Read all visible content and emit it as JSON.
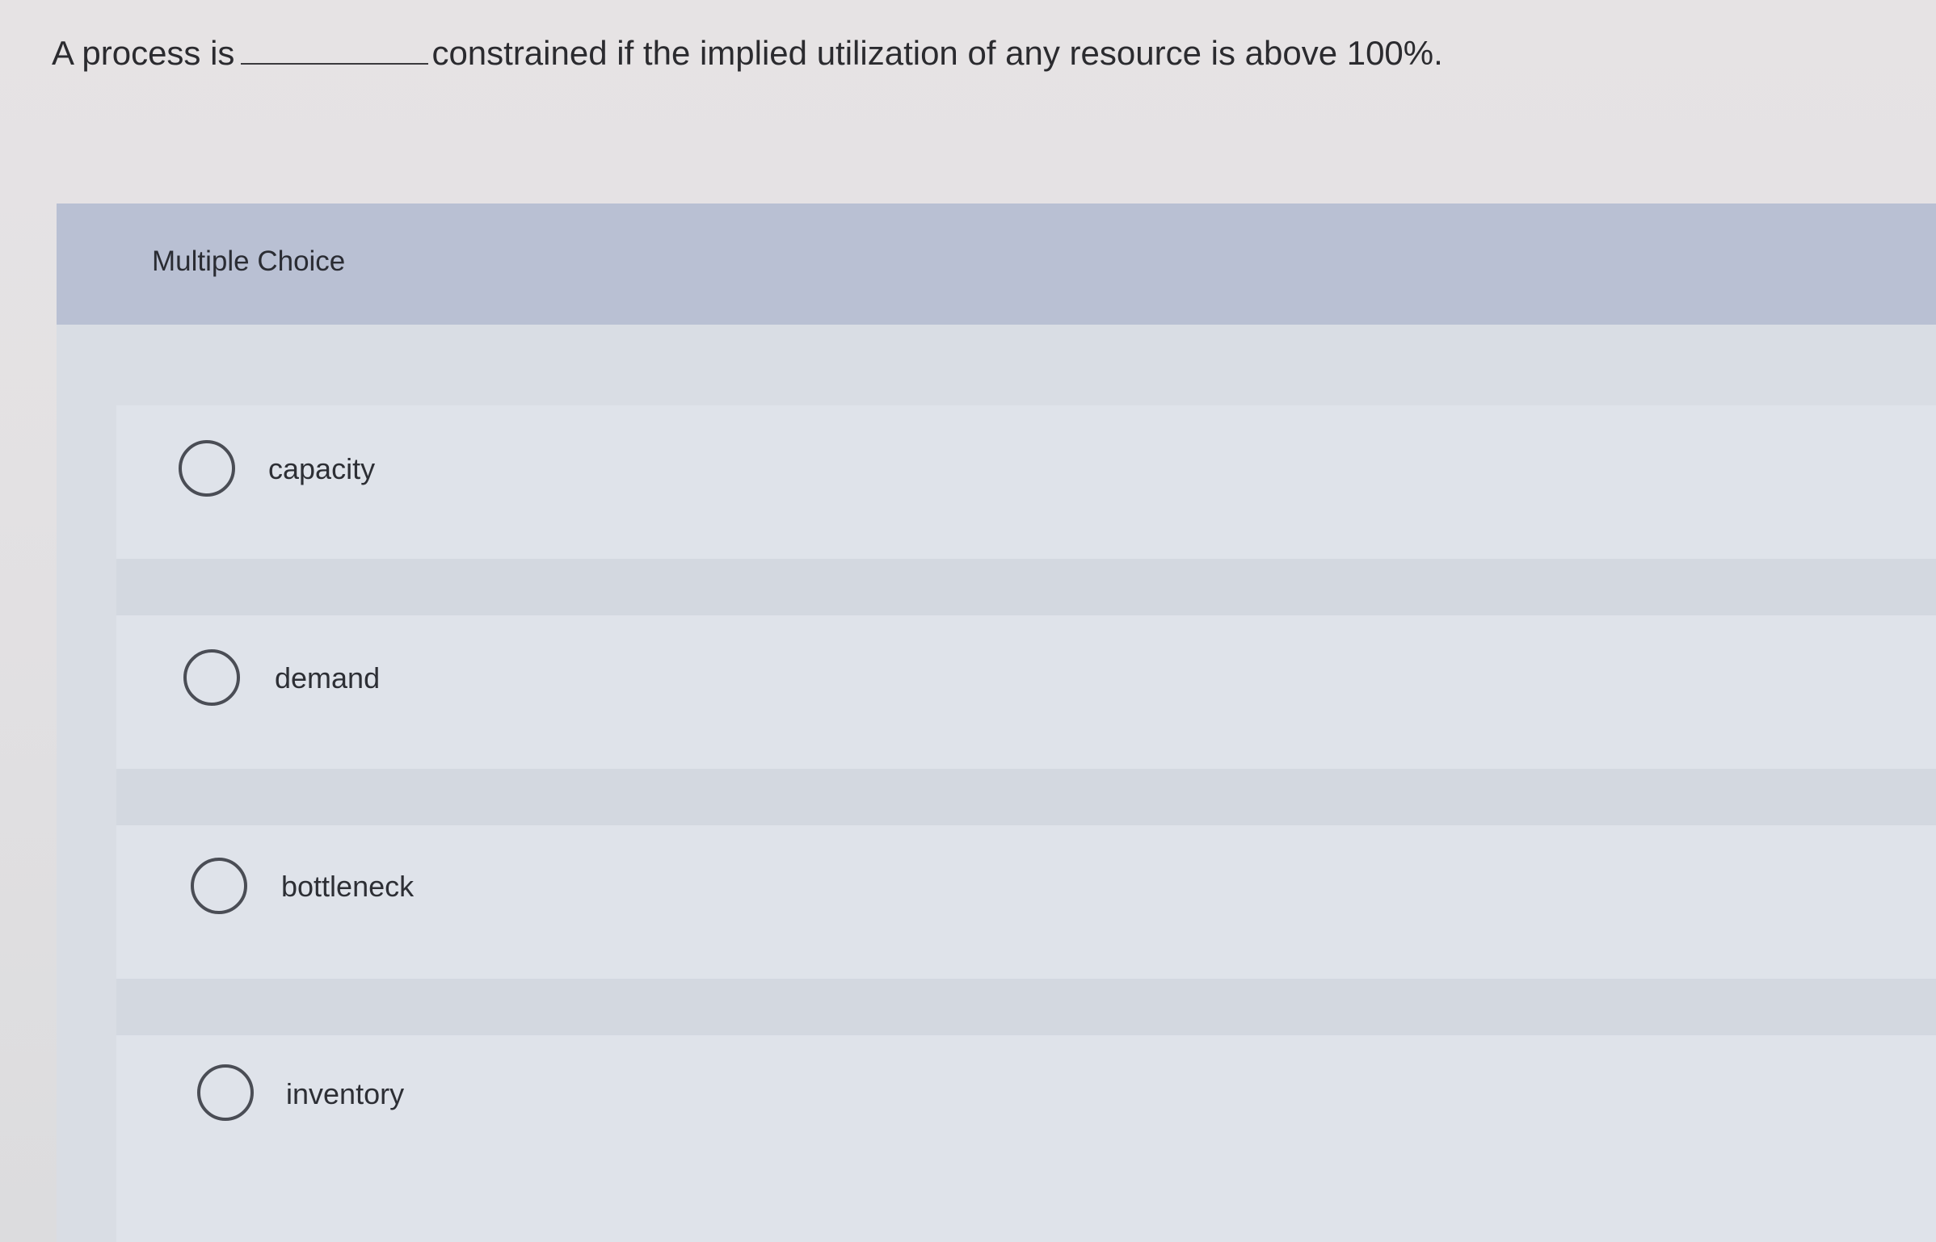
{
  "question": {
    "prefix": "A process is",
    "suffix": "constrained if the implied utilization of any resource is above 100%."
  },
  "panel": {
    "header_label": "Multiple Choice"
  },
  "options": [
    {
      "label": "capacity"
    },
    {
      "label": "demand"
    },
    {
      "label": "bottleneck"
    },
    {
      "label": "inventory"
    }
  ],
  "colors": {
    "header_bg": "#b9c0d3",
    "panel_bg": "#dfe3ea",
    "text": "#2b2b2f"
  }
}
